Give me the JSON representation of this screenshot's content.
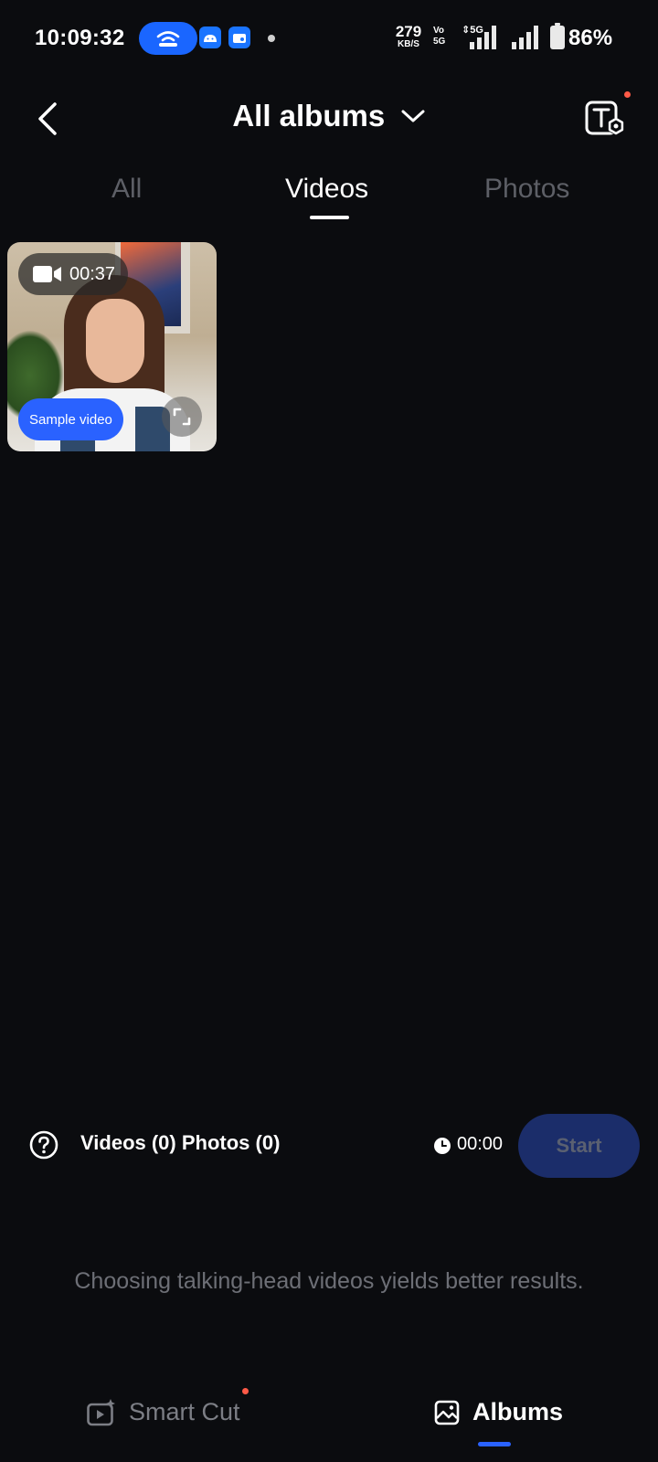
{
  "status_bar": {
    "time": "10:09:32",
    "net_speed": "279",
    "net_speed_unit": "KB/S",
    "volte": "Vo\n5G",
    "network": "5G",
    "battery": "86%",
    "accent": "#1a66ff"
  },
  "header": {
    "title": "All albums",
    "icons": [
      "back-arrow-icon",
      "chevron-down-icon",
      "text-settings-icon"
    ]
  },
  "tabs": [
    {
      "label": "All",
      "active": false
    },
    {
      "label": "Videos",
      "active": true
    },
    {
      "label": "Photos",
      "active": false
    }
  ],
  "media": [
    {
      "type": "video",
      "duration": "00:37",
      "badge": "Sample video"
    }
  ],
  "selection": {
    "counts": "Videos (0) Photos (0)",
    "total_duration": "00:00",
    "start_label": "Start"
  },
  "hint": "Choosing talking-head videos yields better results.",
  "bottom_nav": [
    {
      "label": "Smart Cut",
      "active": false,
      "icon": "smart-cut-icon"
    },
    {
      "label": "Albums",
      "active": true,
      "icon": "albums-icon"
    }
  ],
  "colors": {
    "background": "#0b0c0f",
    "primary": "#2a62ff",
    "start_disabled": "#1b2d6a",
    "notification_dot": "#ff5a47"
  }
}
